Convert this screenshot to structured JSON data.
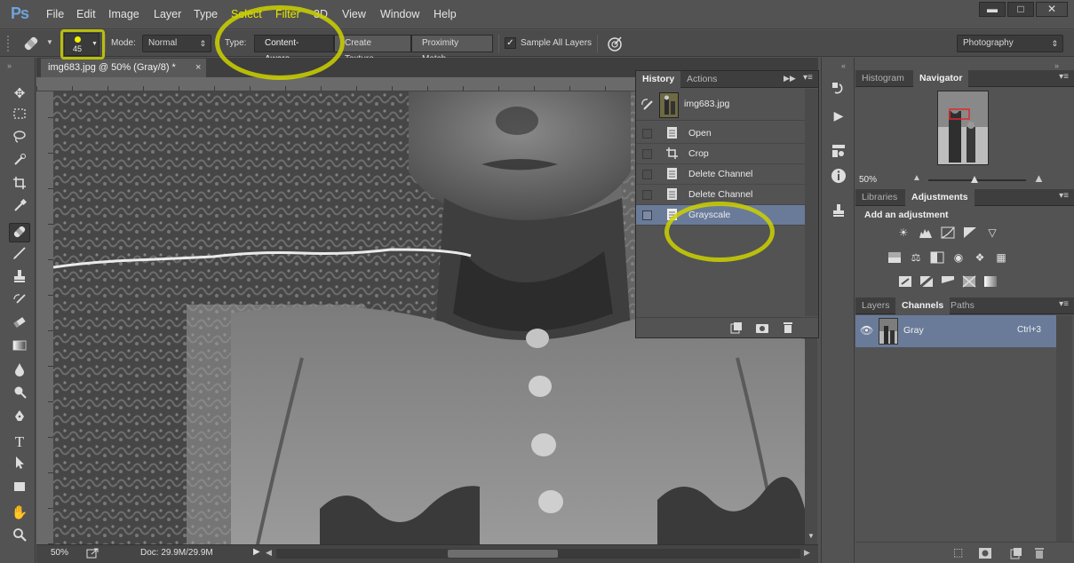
{
  "app": {
    "logo": "Ps"
  },
  "menu": {
    "items": [
      "File",
      "Edit",
      "Image",
      "Layer",
      "Type",
      "Select",
      "Filter",
      "3D",
      "View",
      "Window",
      "Help"
    ]
  },
  "window_controls": {
    "minimize": "▬",
    "maximize": "□",
    "close": "✕"
  },
  "options": {
    "brush_size": "45",
    "mode_label": "Mode:",
    "mode_value": "Normal",
    "type_label": "Type:",
    "type_options": [
      "Content-Aware",
      "Create Texture",
      "Proximity Match"
    ],
    "selected_type": "Content-Aware",
    "sample_all_layers": "Sample All Layers",
    "sample_all_layers_checked": true,
    "workspace": "Photography"
  },
  "document": {
    "tab_title": "img683.jpg @ 50% (Gray/8) *",
    "zoom": "50%",
    "doc_size": "Doc: 29.9M/29.9M"
  },
  "history": {
    "tabs": [
      "History",
      "Actions"
    ],
    "active_tab": "History",
    "snapshot": "img683.jpg",
    "items": [
      {
        "label": "Open",
        "icon": "document-icon"
      },
      {
        "label": "Crop",
        "icon": "crop-icon"
      },
      {
        "label": "Delete Channel",
        "icon": "document-icon"
      },
      {
        "label": "Delete Channel",
        "icon": "document-icon"
      },
      {
        "label": "Grayscale",
        "icon": "document-icon",
        "selected": true
      }
    ]
  },
  "navigator": {
    "tabs": [
      "Histogram",
      "Navigator"
    ],
    "active_tab": "Navigator",
    "zoom": "50%"
  },
  "adjustments": {
    "tabs": [
      "Libraries",
      "Adjustments"
    ],
    "active_tab": "Adjustments",
    "heading": "Add an adjustment"
  },
  "layers_panel": {
    "tabs": [
      "Layers",
      "Channels",
      "Paths"
    ],
    "active_tab": "Channels",
    "channels": [
      {
        "name": "Gray",
        "shortcut": "Ctrl+3"
      }
    ]
  },
  "colors": {
    "menu_highlight": "#e8e800",
    "annotation": "#cdd200",
    "selection": "#6a7b9a",
    "navigator_view_box": "#e0282b"
  },
  "tools": [
    "move-tool",
    "marquee-tool",
    "lasso-tool",
    "quick-selection-tool",
    "crop-tool",
    "eyedropper-tool",
    "spot-healing-brush-tool",
    "brush-tool",
    "clone-stamp-tool",
    "history-brush-tool",
    "eraser-tool",
    "gradient-tool",
    "blur-tool",
    "dodge-tool",
    "pen-tool",
    "type-tool",
    "path-selection-tool",
    "rectangle-tool",
    "hand-tool",
    "zoom-tool"
  ]
}
